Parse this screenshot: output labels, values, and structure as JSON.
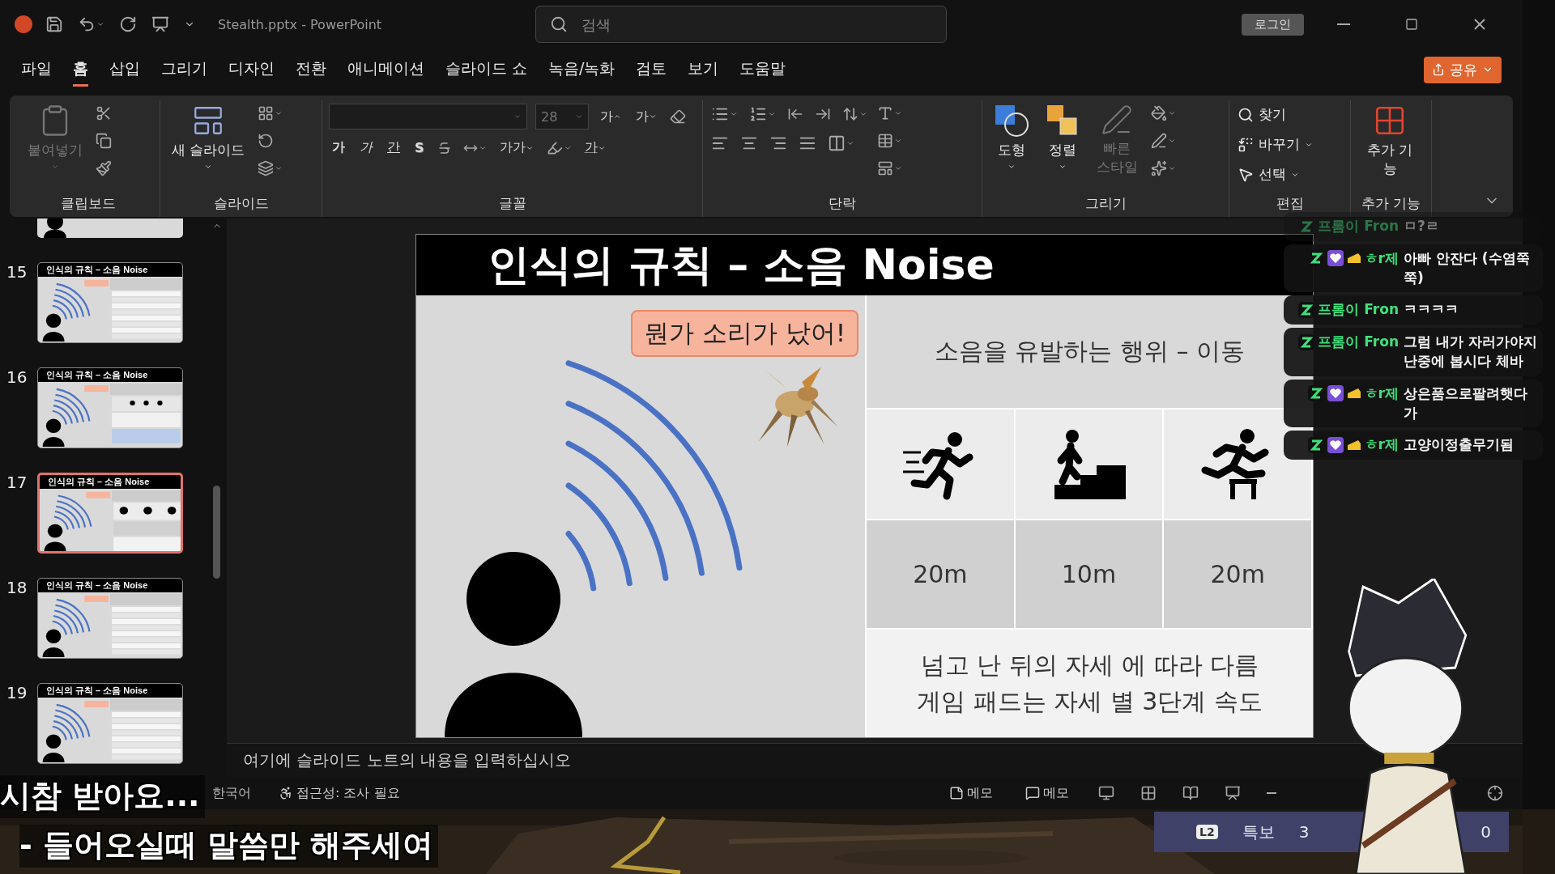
{
  "title_bar": {
    "file": "Stealth.pptx  -  PowerPoint",
    "search_placeholder": "검색",
    "login": "로그인"
  },
  "menu_tabs": [
    {
      "label": "파일",
      "selected": false
    },
    {
      "label": "홈",
      "selected": true
    },
    {
      "label": "삽입",
      "selected": false
    },
    {
      "label": "그리기",
      "selected": false
    },
    {
      "label": "디자인",
      "selected": false
    },
    {
      "label": "전환",
      "selected": false
    },
    {
      "label": "애니메이션",
      "selected": false
    },
    {
      "label": "슬라이드 쇼",
      "selected": false
    },
    {
      "label": "녹음/녹화",
      "selected": false
    },
    {
      "label": "검토",
      "selected": false
    },
    {
      "label": "보기",
      "selected": false
    },
    {
      "label": "도움말",
      "selected": false
    }
  ],
  "share": "공유",
  "ribbon": {
    "clipboard": {
      "label": "클립보드",
      "paste": {
        "label": "붙여넣기",
        "disabled": true
      }
    },
    "slides": {
      "label": "슬라이드",
      "new_slide": "새 슬라이드"
    },
    "font": {
      "label": "글꼴",
      "font_size": "28",
      "grow": "가",
      "shrink": "가",
      "buttons": [
        {
          "text": "가",
          "kind": "bold"
        },
        {
          "text": "가",
          "kind": "italic"
        },
        {
          "text": "간",
          "kind": "underline"
        },
        {
          "text": "S",
          "kind": "shadow"
        }
      ],
      "change_case": "가가",
      "font_color": "가"
    },
    "paragraph": {
      "label": "단락"
    },
    "drawing": {
      "label": "그리기",
      "shapes": "도형",
      "arrange": "정렬",
      "quick_styles": {
        "label": "빠른 스타일",
        "disabled": true
      }
    },
    "editing": {
      "label": "편집",
      "find": "찾기",
      "replace": "바꾸기",
      "select": "선택"
    },
    "addins": {
      "label": "추가 기능",
      "button": "추가 기능"
    }
  },
  "slides_panel": [
    {
      "kind": "partial",
      "selected": false
    },
    {
      "kind": "table",
      "number": "15",
      "title": "인식의 규칙 – 소음 Noise",
      "selected": false
    },
    {
      "kind": "icons",
      "number": "16",
      "title": "인식의 규칙 – 소음 Noise",
      "selected": false
    },
    {
      "kind": "current",
      "number": "17",
      "title": "인식의 규칙 – 소음 Noise",
      "selected": true
    },
    {
      "kind": "table",
      "number": "18",
      "title": "인식의 규칙 – 소음 Noise",
      "selected": false
    },
    {
      "kind": "table",
      "number": "19",
      "title": "인식의 규칙 – 소음 Noise",
      "selected": false
    }
  ],
  "slide": {
    "title": "인식의 규칙 – 소음 Noise",
    "bubble": "뭔가 소리가 났어!",
    "table_header": "소음을 유발하는 행위 – 이동",
    "actions": [
      {
        "kind": "run",
        "distance": "20m"
      },
      {
        "kind": "stairs",
        "distance": "10m"
      },
      {
        "kind": "hurdle",
        "distance": "20m"
      }
    ],
    "notes": [
      "넘고 난 뒤의 자세 에 따라 다름",
      "게임 패드는 자세 별 3단계 속도"
    ]
  },
  "notes_placeholder": "여기에 슬라이드 노트의 내용을 입력하십시오",
  "status_bar": {
    "language": "한국어",
    "accessibility": "접근성: 조사 필요",
    "notes": "메모",
    "comments": "메모"
  },
  "chat": [
    {
      "name": "프롬이 Fron",
      "text": "ㅁ?ㄹ",
      "kind": "basic",
      "faded": true
    },
    {
      "name": "ㅎr제",
      "text": "아빠 안잔다 (수염쭉쭉)",
      "kind": "member",
      "faded": false
    },
    {
      "name": "프롬이 Fron",
      "text": "ㅋㅋㅋㅋ",
      "kind": "basic",
      "faded": false
    },
    {
      "name": "프롬이 Fron",
      "text": "그럼 내가 자러가야지 난중에 봅시다 체바",
      "kind": "basic",
      "faded": false
    },
    {
      "name": "ㅎr제",
      "text": "상은품으로팔려햇다가",
      "kind": "member",
      "faded": false
    },
    {
      "name": "ㅎr제",
      "text": "고양이정출무기됨",
      "kind": "member",
      "faded": false
    }
  ],
  "subtitles": [
    "시참 받아요...",
    "- 들어오실때 말씀만 해주세여"
  ],
  "alert_widget": {
    "badge": "L2",
    "label": "특보",
    "value": "3",
    "end_value": "0"
  }
}
